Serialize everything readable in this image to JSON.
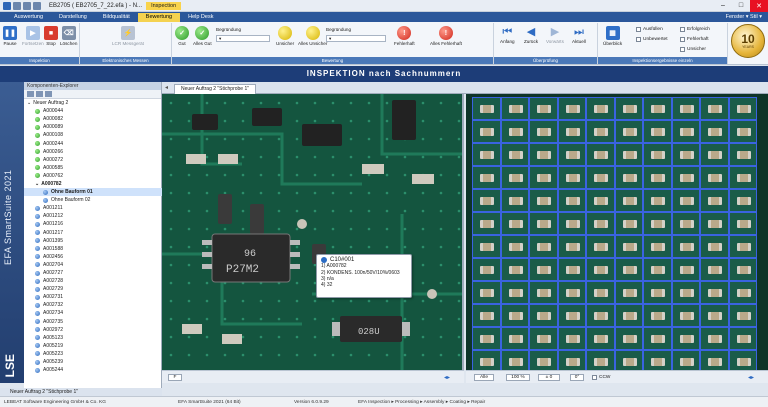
{
  "window": {
    "title": "EB2705 ( EB2705_7_22.efa ) - N...",
    "context_tab": "Inspection",
    "controls": [
      "–",
      "□",
      "✕"
    ]
  },
  "ribbon_tabs": [
    {
      "label": "Auswertung",
      "active": false
    },
    {
      "label": "Darstellung",
      "active": false
    },
    {
      "label": "Bildqualität",
      "active": false
    },
    {
      "label": "Bewertung",
      "active": true
    },
    {
      "label": "Help Desk",
      "active": false
    }
  ],
  "ribbon_right": "Fenster ▾   Stil ▾",
  "groups": {
    "inspektion": {
      "label": "Inspektion",
      "buttons": [
        "Pause",
        "Fortsetzen",
        "Stop",
        "Löschen"
      ]
    },
    "elektronisches_messen": {
      "label": "Elektronisches Messen",
      "buttons": [
        "LCR Messgerät"
      ]
    },
    "bewertung": {
      "label": "Bewertung",
      "buttons": [
        "Gut",
        "Alles Gut",
        "Unsicher",
        "Alles Unsicher",
        "Fehlerhaft",
        "Alles Fehlerhaft"
      ],
      "begruendung_label": "Begründung"
    },
    "ueberpruefung": {
      "label": "Überprüfung",
      "buttons": [
        "Anfang",
        "Zurück",
        "Vorwärts",
        "Aktuell"
      ]
    },
    "inspektionsergebnisse": {
      "label": "Inspektionsergebnisse einzeln",
      "overview_button": "Überblick",
      "checks": [
        "Ausfüllen",
        "Unbewertet",
        "Erfolgreich",
        "Fehlerhaft",
        "Unsicher"
      ]
    }
  },
  "badge": {
    "number": "10",
    "text": "YEARS"
  },
  "banner": "INSPEKTION nach Sachnummern",
  "sidebar_title": "EFA SmartSuite 2021",
  "sidebar_logo": "LSE",
  "explorer": {
    "header": "Komponenten-Explorer",
    "tree": [
      {
        "label": "Neuer Auftrag 2",
        "level": 0,
        "dot": "none",
        "expander": "⌄"
      },
      {
        "label": "A000044",
        "level": 1,
        "dot": "g"
      },
      {
        "label": "A000082",
        "level": 1,
        "dot": "g"
      },
      {
        "label": "A000089",
        "level": 1,
        "dot": "g"
      },
      {
        "label": "A000108",
        "level": 1,
        "dot": "g"
      },
      {
        "label": "A000244",
        "level": 1,
        "dot": "g"
      },
      {
        "label": "A000266",
        "level": 1,
        "dot": "g"
      },
      {
        "label": "A000272",
        "level": 1,
        "dot": "g"
      },
      {
        "label": "A000585",
        "level": 1,
        "dot": "g"
      },
      {
        "label": "A000762",
        "level": 1,
        "dot": "g"
      },
      {
        "label": "A000782",
        "level": 1,
        "dot": "none",
        "expander": "⌄",
        "bold": true
      },
      {
        "label": "Ohne Bauform 01",
        "level": 2,
        "dot": "b",
        "selected": true
      },
      {
        "label": "Ohne Bauform 02",
        "level": 2,
        "dot": "b"
      },
      {
        "label": "A001211",
        "level": 1,
        "dot": "b"
      },
      {
        "label": "A001212",
        "level": 1,
        "dot": "b"
      },
      {
        "label": "A001216",
        "level": 1,
        "dot": "b"
      },
      {
        "label": "A001217",
        "level": 1,
        "dot": "b"
      },
      {
        "label": "A001395",
        "level": 1,
        "dot": "b"
      },
      {
        "label": "A001588",
        "level": 1,
        "dot": "b"
      },
      {
        "label": "A002456",
        "level": 1,
        "dot": "b"
      },
      {
        "label": "A002704",
        "level": 1,
        "dot": "b"
      },
      {
        "label": "A002727",
        "level": 1,
        "dot": "b"
      },
      {
        "label": "A002728",
        "level": 1,
        "dot": "b"
      },
      {
        "label": "A002729",
        "level": 1,
        "dot": "b"
      },
      {
        "label": "A002731",
        "level": 1,
        "dot": "b"
      },
      {
        "label": "A002732",
        "level": 1,
        "dot": "b"
      },
      {
        "label": "A002734",
        "level": 1,
        "dot": "b"
      },
      {
        "label": "A002735",
        "level": 1,
        "dot": "b"
      },
      {
        "label": "A002972",
        "level": 1,
        "dot": "b"
      },
      {
        "label": "A005123",
        "level": 1,
        "dot": "b"
      },
      {
        "label": "A005219",
        "level": 1,
        "dot": "b"
      },
      {
        "label": "A005223",
        "level": 1,
        "dot": "b"
      },
      {
        "label": "A005239",
        "level": 1,
        "dot": "b"
      },
      {
        "label": "A005244",
        "level": 1,
        "dot": "b"
      }
    ]
  },
  "doc_tab": "Neuer Auftrag 2 \"Stichprobe 1\"",
  "pcb_markings": {
    "ic_top": "96",
    "ic_bottom": "P27M2",
    "chip_label": "028U"
  },
  "tooltip": {
    "title": "C10#001",
    "lines": [
      "1) A000782",
      "2) KONDENS. 100n/50V/10%/0603",
      "3) n/a",
      "4) 32"
    ]
  },
  "bottom_left": {
    "field": "F"
  },
  "bottom_right": {
    "mode": "Alle",
    "zoom": "100 %",
    "offset": "± 0",
    "rotation": "0°",
    "ccw_label": "CCW"
  },
  "bottom_tab": "Neuer Auftrag 2 \"Stichprobe 1\"",
  "status": {
    "company": "LEBEAT Software Engineering GmbH & Co. KG",
    "product": "EFA SmartSuite 2021 (64 Bit)",
    "version": "Version 6.0.9.29",
    "path": "EFA Inspection ▸ Processing ▸ Assembly ▸ Coating ▸ Repair"
  },
  "thumbnail_count": 120,
  "colors": {
    "ribbon_blue": "#2b579a",
    "banner": "#1d3d78",
    "selection_border": "#3a63e0",
    "active_tab": "#f4d250"
  }
}
